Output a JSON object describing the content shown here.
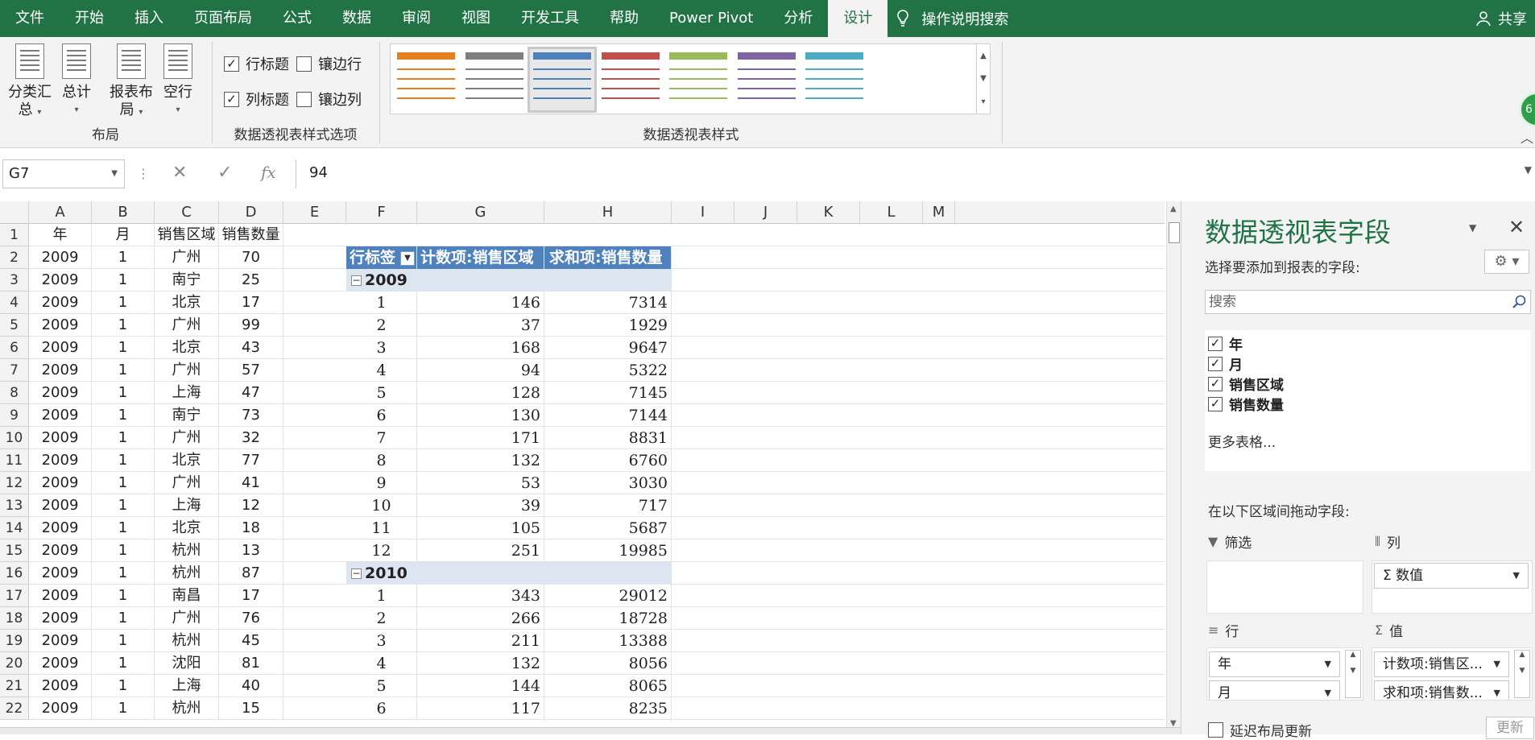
{
  "ribbon_tabs": [
    "文件",
    "开始",
    "插入",
    "页面布局",
    "公式",
    "数据",
    "审阅",
    "视图",
    "开发工具",
    "帮助",
    "Power Pivot",
    "分析",
    "设计"
  ],
  "active_tab": "设计",
  "tell_me": "操作说明搜索",
  "share": "共享",
  "avatar_text": "6",
  "groups": {
    "layout": {
      "label": "布局",
      "buttons": [
        {
          "line1": "分类汇",
          "line2": "总"
        },
        {
          "line1": "总计",
          "line2": ""
        },
        {
          "line1": "报表布",
          "line2": "局"
        },
        {
          "line1": "空行",
          "line2": ""
        }
      ]
    },
    "style_options": {
      "label": "数据透视表样式选项",
      "row_headers": {
        "label": "行标题",
        "checked": true
      },
      "banded_rows": {
        "label": "镶边行",
        "checked": false
      },
      "col_headers": {
        "label": "列标题",
        "checked": true
      },
      "banded_cols": {
        "label": "镶边列",
        "checked": false
      }
    },
    "styles": {
      "label": "数据透视表样式",
      "swatches": [
        "#e67e22",
        "#7f7f7f",
        "#4f81bd",
        "#c0504d",
        "#9bbb59",
        "#8064a2",
        "#4bacc6"
      ],
      "selected_index": 2
    }
  },
  "formula_bar": {
    "name_box": "G7",
    "value": "94",
    "fx": "fx"
  },
  "columns": [
    "A",
    "B",
    "C",
    "D",
    "E",
    "F",
    "G",
    "H",
    "I",
    "J",
    "K",
    "L",
    "M"
  ],
  "rows": [
    "1",
    "2",
    "3",
    "4",
    "5",
    "6",
    "7",
    "8",
    "9",
    "10",
    "11",
    "12",
    "13",
    "14",
    "15",
    "16",
    "17",
    "18",
    "19",
    "20",
    "21",
    "22"
  ],
  "source_header": [
    "年",
    "月",
    "销售区域",
    "销售数量"
  ],
  "source_rows": [
    [
      "2009",
      "1",
      "广州",
      "70"
    ],
    [
      "2009",
      "1",
      "南宁",
      "25"
    ],
    [
      "2009",
      "1",
      "北京",
      "17"
    ],
    [
      "2009",
      "1",
      "广州",
      "99"
    ],
    [
      "2009",
      "1",
      "北京",
      "43"
    ],
    [
      "2009",
      "1",
      "广州",
      "57"
    ],
    [
      "2009",
      "1",
      "上海",
      "47"
    ],
    [
      "2009",
      "1",
      "南宁",
      "73"
    ],
    [
      "2009",
      "1",
      "广州",
      "32"
    ],
    [
      "2009",
      "1",
      "北京",
      "77"
    ],
    [
      "2009",
      "1",
      "广州",
      "41"
    ],
    [
      "2009",
      "1",
      "上海",
      "12"
    ],
    [
      "2009",
      "1",
      "北京",
      "18"
    ],
    [
      "2009",
      "1",
      "杭州",
      "13"
    ],
    [
      "2009",
      "1",
      "杭州",
      "87"
    ],
    [
      "2009",
      "1",
      "南昌",
      "17"
    ],
    [
      "2009",
      "1",
      "广州",
      "76"
    ],
    [
      "2009",
      "1",
      "杭州",
      "45"
    ],
    [
      "2009",
      "1",
      "沈阳",
      "81"
    ],
    [
      "2009",
      "1",
      "上海",
      "40"
    ],
    [
      "2009",
      "1",
      "杭州",
      "15"
    ]
  ],
  "pivot": {
    "row_label": "行标签",
    "count_label": "计数项:销售区域",
    "sum_label": "求和项:销售数量",
    "groups": [
      {
        "year": "2009",
        "rows": [
          [
            "1",
            "146",
            "7314"
          ],
          [
            "2",
            "37",
            "1929"
          ],
          [
            "3",
            "168",
            "9647"
          ],
          [
            "4",
            "94",
            "5322"
          ],
          [
            "5",
            "128",
            "7145"
          ],
          [
            "6",
            "130",
            "7144"
          ],
          [
            "7",
            "171",
            "8831"
          ],
          [
            "8",
            "132",
            "6760"
          ],
          [
            "9",
            "53",
            "3030"
          ],
          [
            "10",
            "39",
            "717"
          ],
          [
            "11",
            "105",
            "5687"
          ],
          [
            "12",
            "251",
            "19985"
          ]
        ]
      },
      {
        "year": "2010",
        "rows": [
          [
            "1",
            "343",
            "29012"
          ],
          [
            "2",
            "266",
            "18728"
          ],
          [
            "3",
            "211",
            "13388"
          ],
          [
            "4",
            "132",
            "8056"
          ],
          [
            "5",
            "144",
            "8065"
          ],
          [
            "6",
            "117",
            "8235"
          ]
        ]
      }
    ]
  },
  "pane": {
    "title": "数据透视表字段",
    "subtitle": "选择要添加到报表的字段:",
    "search_placeholder": "搜索",
    "fields": [
      {
        "name": "年",
        "checked": true
      },
      {
        "name": "月",
        "checked": true
      },
      {
        "name": "销售区域",
        "checked": true
      },
      {
        "name": "销售数量",
        "checked": true
      }
    ],
    "more_tables": "更多表格...",
    "drag_label": "在以下区域间拖动字段:",
    "filters_label": "筛选",
    "columns_label": "列",
    "rows_label": "行",
    "values_label": "值",
    "columns_items": [
      "Σ 数值"
    ],
    "rows_items": [
      "年",
      "月"
    ],
    "values_items": [
      "计数项:销售区...",
      "求和项:销售数..."
    ],
    "defer_label": "延迟布局更新",
    "update_label": "更新"
  }
}
